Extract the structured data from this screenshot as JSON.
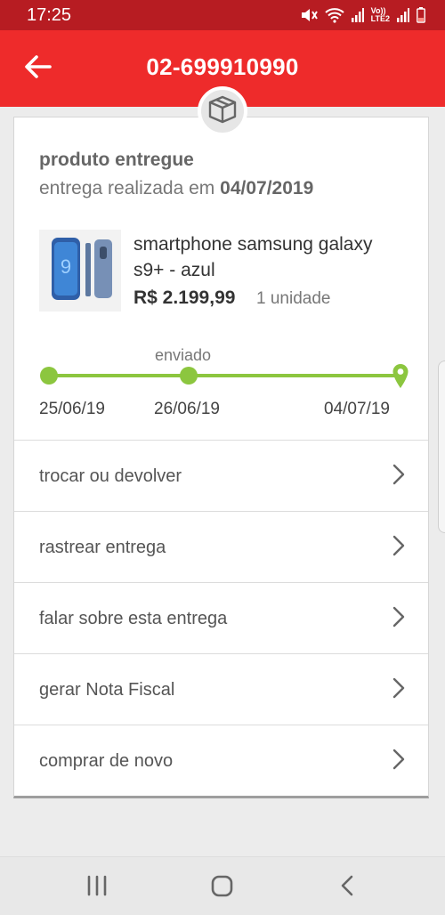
{
  "status_bar": {
    "time": "17:25",
    "icons": [
      "mute-icon",
      "wifi-icon",
      "signal-icon",
      "volte-lte2-icon",
      "signal-icon",
      "battery-low-icon"
    ],
    "volte_label": "Vo))",
    "lte_label": "LTE2"
  },
  "app_bar": {
    "title": "02-699910990",
    "back_icon": "arrow-left-icon",
    "badge_icon": "package-box-icon",
    "color": "#ee2b2b"
  },
  "order": {
    "status_title": "produto entregue",
    "delivery_prefix": "entrega realizada em",
    "delivery_date": "04/07/2019",
    "product": {
      "name": "smartphone samsung galaxy s9+ - azul",
      "price": "R$ 2.199,99",
      "quantity": "1 unidade",
      "thumb_icon": "smartphone-icon"
    },
    "timeline": {
      "stage_label": "enviado",
      "dates": [
        "25/06/19",
        "26/06/19",
        "04/07/19"
      ],
      "end_icon": "location-pin-icon",
      "progress_color": "#8cc63f"
    }
  },
  "menu": {
    "items": [
      {
        "label": "trocar ou devolver"
      },
      {
        "label": "rastrear entrega"
      },
      {
        "label": "falar sobre esta entrega"
      },
      {
        "label": "gerar Nota Fiscal"
      },
      {
        "label": "comprar de novo"
      }
    ],
    "chevron_icon": "chevron-right-icon"
  },
  "nav_bar": {
    "buttons": [
      "recent-apps-icon",
      "home-icon",
      "back-icon"
    ]
  }
}
